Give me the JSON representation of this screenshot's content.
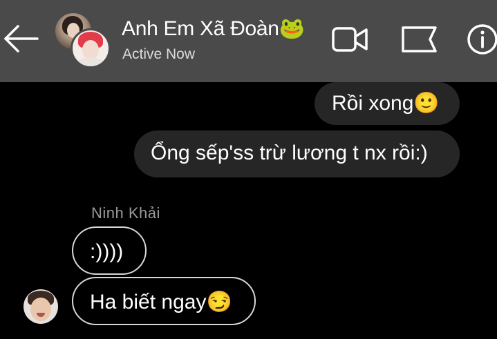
{
  "header": {
    "title": "Anh Em Xã Đoàn🐸",
    "status": "Active Now"
  },
  "icons": {
    "back": "arrow-left-icon",
    "video": "video-camera-icon",
    "flag": "flag-icon",
    "info": "info-icon"
  },
  "messages": [
    {
      "direction": "outgoing",
      "text": "Rồi xong🙂"
    },
    {
      "direction": "outgoing",
      "text": "Ổng sếp'ss trừ lương t nx rồi:)"
    },
    {
      "direction": "incoming",
      "sender": "Ninh  Khải",
      "text": ":))))"
    },
    {
      "direction": "incoming",
      "text": "Ha biết ngay😏"
    }
  ],
  "colors": {
    "header_bg": "#4a4a4a",
    "background": "#000000",
    "outgoing_bubble": "#262626",
    "incoming_border": "#d8d8d8"
  }
}
